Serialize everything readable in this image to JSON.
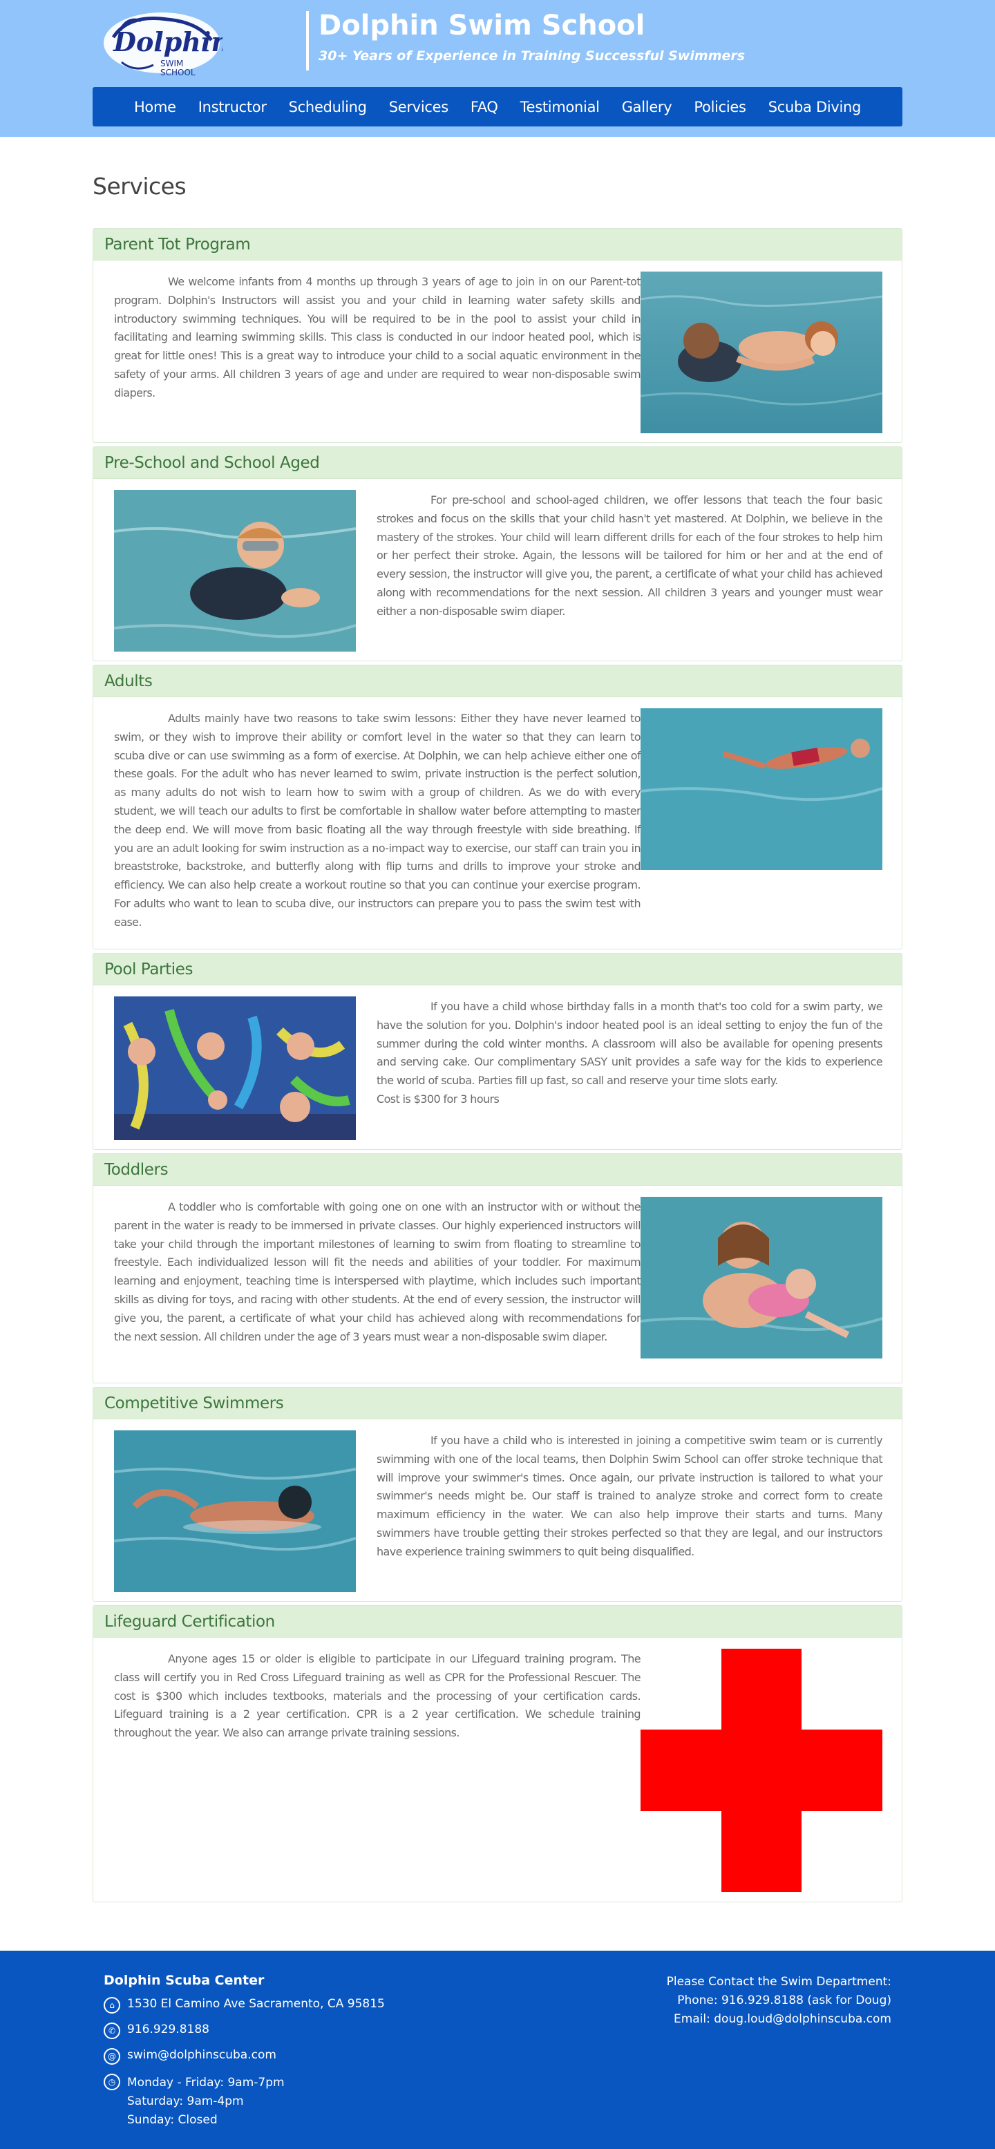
{
  "header": {
    "logo_text": "Dolphin",
    "logo_subtext_1": "SWIM",
    "logo_subtext_2": "SCHOOL",
    "title": "Dolphin Swim School",
    "tagline": "30+ Years of Experience in Training Successful Swimmers"
  },
  "nav": [
    "Home",
    "Instructor",
    "Scheduling",
    "Services",
    "FAQ",
    "Testimonial",
    "Gallery",
    "Policies",
    "Scuba Diving"
  ],
  "page_title": "Services",
  "sections": [
    {
      "heading": "Parent Tot Program",
      "text": "We welcome infants from 4 months up through 3 years of age to join in on our Parent-tot program. Dolphin's Instructors will assist you and your child in learning water safety skills and introductory swimming techniques. You will be required to be in the pool to assist your child in facilitating and learning swimming skills. This class is conducted in our indoor heated pool, which is great for little ones! This is a great way to introduce your child to a social aquatic environment in the safety of your arms. All children 3 years of age and under are required to wear non-disposable swim diapers."
    },
    {
      "heading": "Pre-School and School Aged",
      "text": "For pre-school and school-aged children, we offer lessons that teach the four basic strokes and focus on the skills that your child hasn't yet mastered. At Dolphin, we believe in the mastery of the strokes. Your child will learn different drills for each of the four strokes to help him or her perfect their stroke. Again, the lessons will be tailored for him or her and at the end of every session, the instructor will give you, the parent, a certificate of what your child has achieved along with recommendations for the next session. All children 3 years and younger must wear either a non-disposable swim diaper."
    },
    {
      "heading": "Adults",
      "text": "Adults mainly have two reasons to take swim lessons: Either they have never learned to swim, or they wish to improve their ability or comfort level in the water so that they can learn to scuba dive or can use swimming as a form of exercise. At Dolphin, we can help achieve either one of these goals. For the adult who has never learned to swim, private instruction is the perfect solution, as many adults do not wish to learn how to swim with a group of children. As we do with every student, we will teach our adults to first be comfortable in shallow water before attempting to master the deep end. We will move from basic floating all the way through freestyle with side breathing. If you are an adult looking for swim instruction as a no-impact way to exercise, our staff can train you in breaststroke, backstroke, and butterfly along with flip turns and drills to improve your stroke and efficiency. We can also help create a workout routine so that you can continue your exercise program. For adults who want to lean to scuba dive, our instructors can prepare you to pass the swim test with ease."
    },
    {
      "heading": "Pool Parties",
      "text": "If you have a child whose birthday falls in a month that's too cold for a swim party, we have the solution for you. Dolphin's indoor heated pool is an ideal setting to enjoy the fun of the summer during the cold winter months. A classroom will also be available for opening presents and serving cake. Our complimentary SASY unit provides a safe way for the kids to experience the world of scuba. Parties fill up fast, so call and reserve your time slots early.",
      "cost": "Cost is $300 for 3 hours"
    },
    {
      "heading": "Toddlers",
      "text": "A toddler who is comfortable with going one on one with an instructor with or without the parent in the water is ready to be immersed in private classes. Our highly experienced instructors will take your child through the important milestones of learning to swim from floating to streamline to freestyle. Each individualized lesson will fit the needs and abilities of your toddler. For maximum learning and enjoyment, teaching time is interspersed with playtime, which includes such important skills as diving for toys, and racing with other students. At the end of every session, the instructor will give you, the parent, a certificate of what your child has achieved along with recommendations for the next session. All children under the age of 3 years must wear a non-disposable swim diaper."
    },
    {
      "heading": "Competitive Swimmers",
      "text": "If you have a child who is interested in joining a competitive swim team or is currently swimming with one of the local teams, then Dolphin Swim School can offer stroke technique that will improve your swimmer's times. Once again, our private instruction is tailored to what your swimmer's needs might be. Our staff is trained to analyze stroke and correct form to create maximum efficiency in the water. We can also help improve their starts and turns. Many swimmers have trouble getting their strokes perfected so that they are legal, and our instructors have experience training swimmers to quit being disqualified."
    },
    {
      "heading": "Lifeguard Certification",
      "text": "Anyone ages 15 or older is eligible to participate in our Lifeguard training program. The class will certify you in Red Cross Lifeguard training as well as CPR for the Professional Rescuer. The cost is $300 which includes textbooks, materials and the processing of your certification cards. Lifeguard training is a 2 year certification. CPR is a 2 year certification. We schedule training throughout the year. We also can arrange private training sessions."
    }
  ],
  "footer": {
    "title": "Dolphin Scuba Center",
    "address": "1530 El Camino Ave Sacramento, CA 95815",
    "phone": "916.929.8188",
    "email": "swim@dolphinscuba.com",
    "hours_1": "Monday - Friday: 9am-7pm",
    "hours_2": "Saturday: 9am-4pm",
    "hours_3": "Sunday: Closed",
    "contact_title": "Please Contact the Swim Department:",
    "contact_phone": "Phone: 916.929.8188 (ask for Doug)",
    "contact_email": "Email: doug.loud@dolphinscuba.com"
  },
  "colors": {
    "header_bg": "#91c4fa",
    "nav_bg": "#0a56c0",
    "panel_heading_bg": "#dff0d8",
    "panel_heading_text": "#3c763d",
    "footer_bg": "#0a56c0",
    "red_cross": "#ff0000"
  }
}
